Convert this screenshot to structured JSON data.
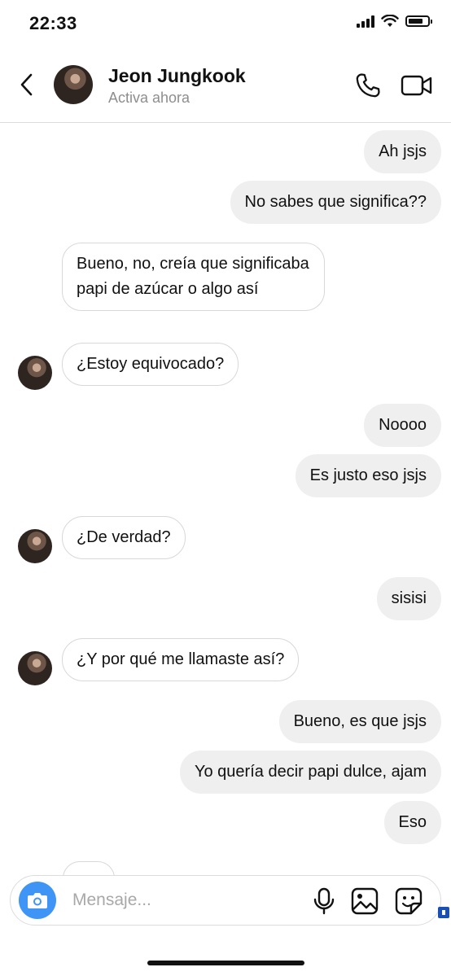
{
  "status_bar": {
    "time": "22:33",
    "battery_level": 0.75
  },
  "header": {
    "contact_name": "Jeon Jungkook",
    "contact_status": "Activa ahora"
  },
  "messages": [
    {
      "from": "me",
      "text": "Ah jsjs"
    },
    {
      "from": "me",
      "text": "No sabes que significa??"
    },
    {
      "from": "them",
      "text": "Bueno, no, creía que significaba papi de azúcar o algo así"
    },
    {
      "from": "them",
      "text": "¿Estoy equivocado?"
    },
    {
      "from": "me",
      "text": "Noooo"
    },
    {
      "from": "me",
      "text": "Es justo eso jsjs"
    },
    {
      "from": "them",
      "text": "¿De verdad?"
    },
    {
      "from": "me",
      "text": "sisisi"
    },
    {
      "from": "them",
      "text": "¿Y por qué me llamaste así?"
    },
    {
      "from": "me",
      "text": "Bueno, es que jsjs"
    },
    {
      "from": "me",
      "text": "Yo quería decir papi dulce, ajam"
    },
    {
      "from": "me",
      "text": "Eso"
    }
  ],
  "composer": {
    "placeholder": "Mensaje..."
  },
  "colors": {
    "accent": "#3f95f6",
    "outgoing_bubble": "#efefef",
    "incoming_border": "#d8d8d8"
  }
}
